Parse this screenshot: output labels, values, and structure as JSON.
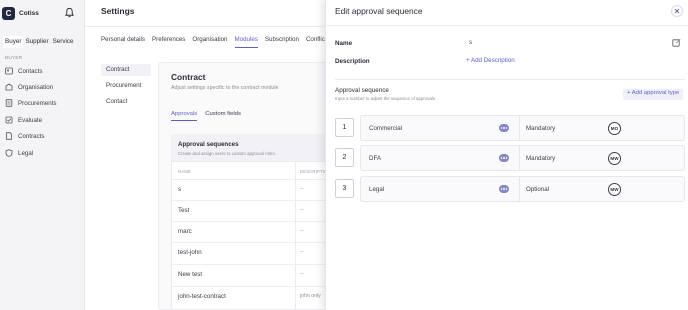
{
  "brand": {
    "logo_letter": "C",
    "name": "Cotiss"
  },
  "roles": [
    "Buyer",
    "Supplier",
    "Service"
  ],
  "sidebar": {
    "section_label": "BUYER",
    "items": [
      {
        "label": "Contacts",
        "icon": "contacts-icon"
      },
      {
        "label": "Organisation",
        "icon": "organisation-icon"
      },
      {
        "label": "Procurements",
        "icon": "procurements-icon"
      },
      {
        "label": "Evaluate",
        "icon": "evaluate-icon"
      },
      {
        "label": "Contracts",
        "icon": "contracts-icon"
      },
      {
        "label": "Legal",
        "icon": "legal-icon"
      }
    ]
  },
  "header": {
    "title": "Settings"
  },
  "tabs": [
    "Personal details",
    "Preferences",
    "Organisation",
    "Modules",
    "Subscription",
    "Conflict"
  ],
  "active_tab": "Modules",
  "sub_nav": [
    "Contract",
    "Procurement",
    "Contact"
  ],
  "contract": {
    "title": "Contract",
    "subtitle": "Adjust settings specific to the contract module",
    "tabs": [
      "Approvals",
      "Custom fields"
    ],
    "approvals_title": "Approval sequences",
    "approvals_desc": "Create and assign users to custom approval roles.",
    "columns": [
      "NAME",
      "DESCRIPTION"
    ],
    "rows": [
      {
        "name": "s",
        "desc": "--"
      },
      {
        "name": "Test",
        "desc": "--"
      },
      {
        "name": "marc",
        "desc": "--"
      },
      {
        "name": "test-john",
        "desc": "--"
      },
      {
        "name": "New test",
        "desc": "--"
      },
      {
        "name": "john-test-contract",
        "desc": "john only"
      }
    ]
  },
  "overlay": {
    "title": "Edit approval sequence",
    "name_label": "Name",
    "name_value": "s",
    "description_label": "Description",
    "add_description": "+ Add Description",
    "sequence_label": "Approval sequence",
    "sequence_hint": "Input a number to adjust the sequence of approvals",
    "add_approval_type": "+ Add approval type",
    "steps": [
      {
        "num": "1",
        "name": "Commercial",
        "requirement": "Mandatory",
        "avatar": "MO"
      },
      {
        "num": "2",
        "name": "DFA",
        "requirement": "Mandatory",
        "avatar": "MW"
      },
      {
        "num": "3",
        "name": "Legal",
        "requirement": "Optional",
        "avatar": "MW"
      }
    ]
  },
  "colors": {
    "accent": "#5d5fc8",
    "brand": "#222844"
  }
}
